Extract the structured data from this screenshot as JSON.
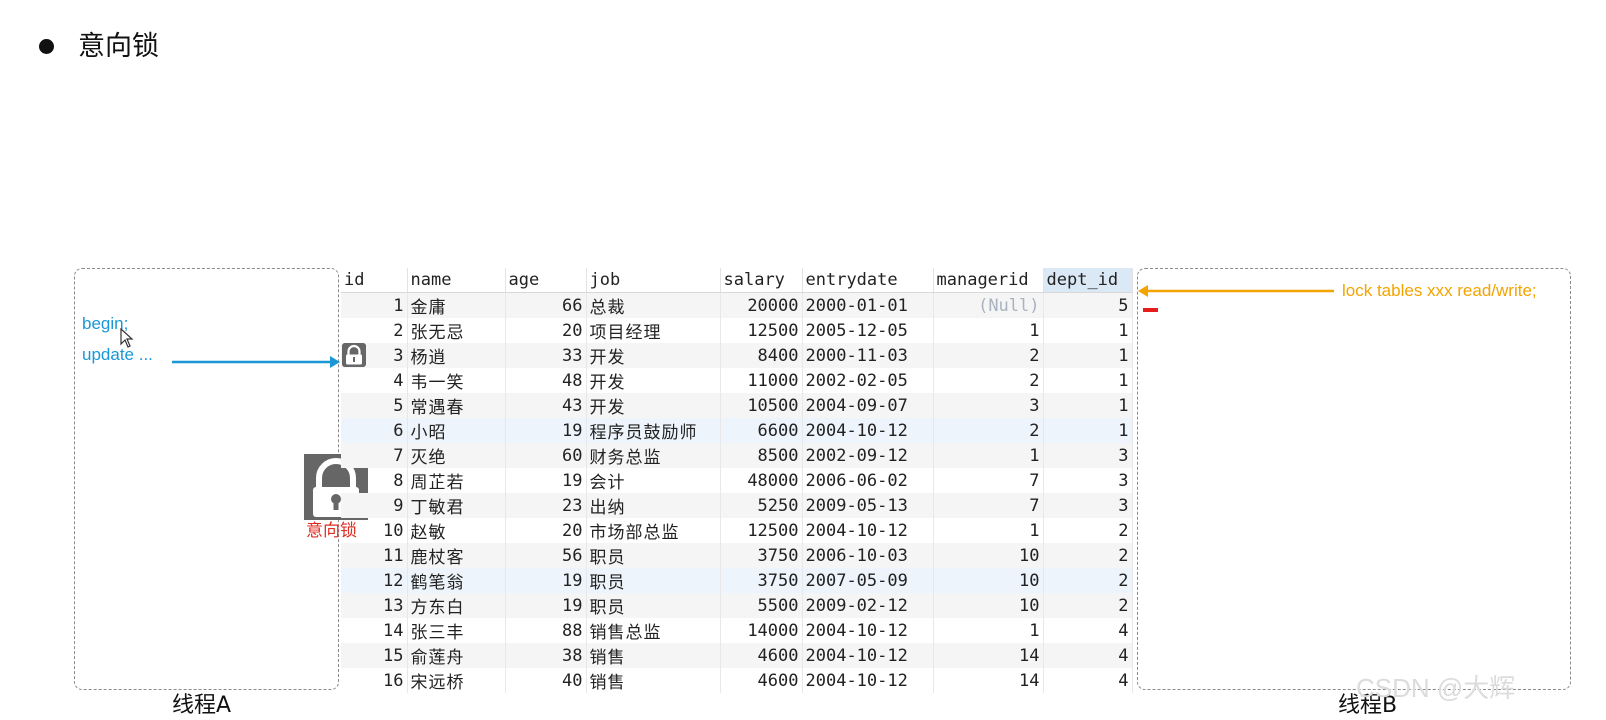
{
  "slide": {
    "title": "意向锁",
    "thread_a_label": "线程A",
    "thread_b_label": "线程B",
    "thread_a_sql": [
      "begin;",
      "update ..."
    ],
    "thread_b_sql": "lock tables xxx read/write;",
    "lock_caption": "意向锁",
    "watermark": "CSDN @大辉",
    "colors": {
      "thread_a": "#1a97d6",
      "thread_b": "#f2a400",
      "lock_caption": "#e02b20",
      "lock_icon": "#666666"
    },
    "icons": [
      "lock-icon",
      "cursor-icon",
      "arrow-right-icon",
      "arrow-left-icon"
    ]
  },
  "table": {
    "columns": [
      "id",
      "name",
      "age",
      "job",
      "salary",
      "entrydate",
      "managerid",
      "dept_id"
    ],
    "selected_column": "dept_id",
    "locked_row_id": "3",
    "rows": [
      [
        "1",
        "金庸",
        "66",
        "总裁",
        "20000",
        "2000-01-01",
        "(Null)",
        "5"
      ],
      [
        "2",
        "张无忌",
        "20",
        "项目经理",
        "12500",
        "2005-12-05",
        "1",
        "1"
      ],
      [
        "3",
        "杨逍",
        "33",
        "开发",
        "8400",
        "2000-11-03",
        "2",
        "1"
      ],
      [
        "4",
        "韦一笑",
        "48",
        "开发",
        "11000",
        "2002-02-05",
        "2",
        "1"
      ],
      [
        "5",
        "常遇春",
        "43",
        "开发",
        "10500",
        "2004-09-07",
        "3",
        "1"
      ],
      [
        "6",
        "小昭",
        "19",
        "程序员鼓励师",
        "6600",
        "2004-10-12",
        "2",
        "1"
      ],
      [
        "7",
        "灭绝",
        "60",
        "财务总监",
        "8500",
        "2002-09-12",
        "1",
        "3"
      ],
      [
        "8",
        "周芷若",
        "19",
        "会计",
        "48000",
        "2006-06-02",
        "7",
        "3"
      ],
      [
        "9",
        "丁敏君",
        "23",
        "出纳",
        "5250",
        "2009-05-13",
        "7",
        "3"
      ],
      [
        "10",
        "赵敏",
        "20",
        "市场部总监",
        "12500",
        "2004-10-12",
        "1",
        "2"
      ],
      [
        "11",
        "鹿杖客",
        "56",
        "职员",
        "3750",
        "2006-10-03",
        "10",
        "2"
      ],
      [
        "12",
        "鹤笔翁",
        "19",
        "职员",
        "3750",
        "2007-05-09",
        "10",
        "2"
      ],
      [
        "13",
        "方东白",
        "19",
        "职员",
        "5500",
        "2009-02-12",
        "10",
        "2"
      ],
      [
        "14",
        "张三丰",
        "88",
        "销售总监",
        "14000",
        "2004-10-12",
        "1",
        "4"
      ],
      [
        "15",
        "俞莲舟",
        "38",
        "销售",
        "4600",
        "2004-10-12",
        "14",
        "4"
      ],
      [
        "16",
        "宋远桥",
        "40",
        "销售",
        "4600",
        "2004-10-12",
        "14",
        "4"
      ]
    ]
  }
}
